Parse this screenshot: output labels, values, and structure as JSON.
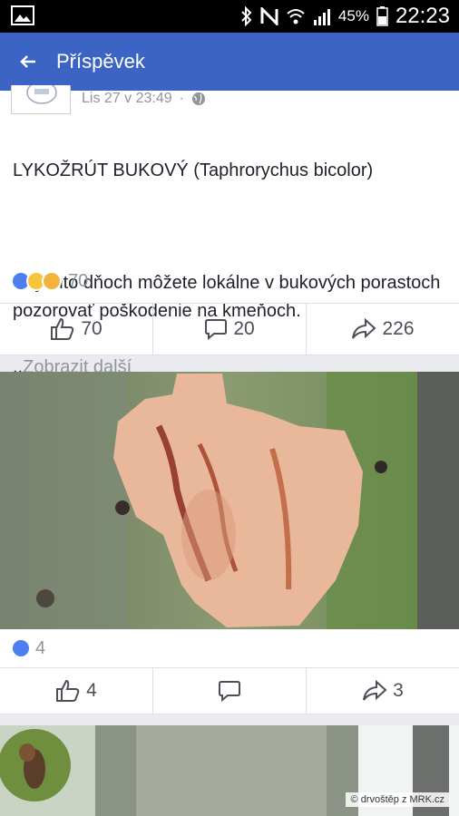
{
  "status_bar": {
    "battery": "45%",
    "time": "22:23",
    "icons": [
      "gallery-icon",
      "bluetooth-icon",
      "nfc-icon",
      "wifi-icon",
      "signal-icon",
      "battery-icon"
    ]
  },
  "appbar": {
    "title": "Příspěvek",
    "back_icon": "back-arrow-icon"
  },
  "post": {
    "timestamp": "Lis 27 v 23:49",
    "separator": "·",
    "audience_icon": "globe-icon",
    "text_title": "LYKOŽRÚT BUKOVÝ (Taphrorychus bicolor)",
    "text_body": "V týchto dňoch môžete lokálne v bukových porastoch pozorovať  poškodenie na kmeňoch.",
    "text_prefix": "..",
    "more_label": "Zobrazit další",
    "reaction_count": "70",
    "like_count": "70",
    "comment_count": "20",
    "share_count": "226"
  },
  "photo_post": {
    "reaction_count": "4",
    "like_count": "4",
    "comment_count": "",
    "share_count": "3"
  },
  "next_post": {
    "watermark": "© drvoštěp z MRK.cz"
  },
  "colors": {
    "appbar": "#3b64c5",
    "like": "#4c7ff0"
  }
}
